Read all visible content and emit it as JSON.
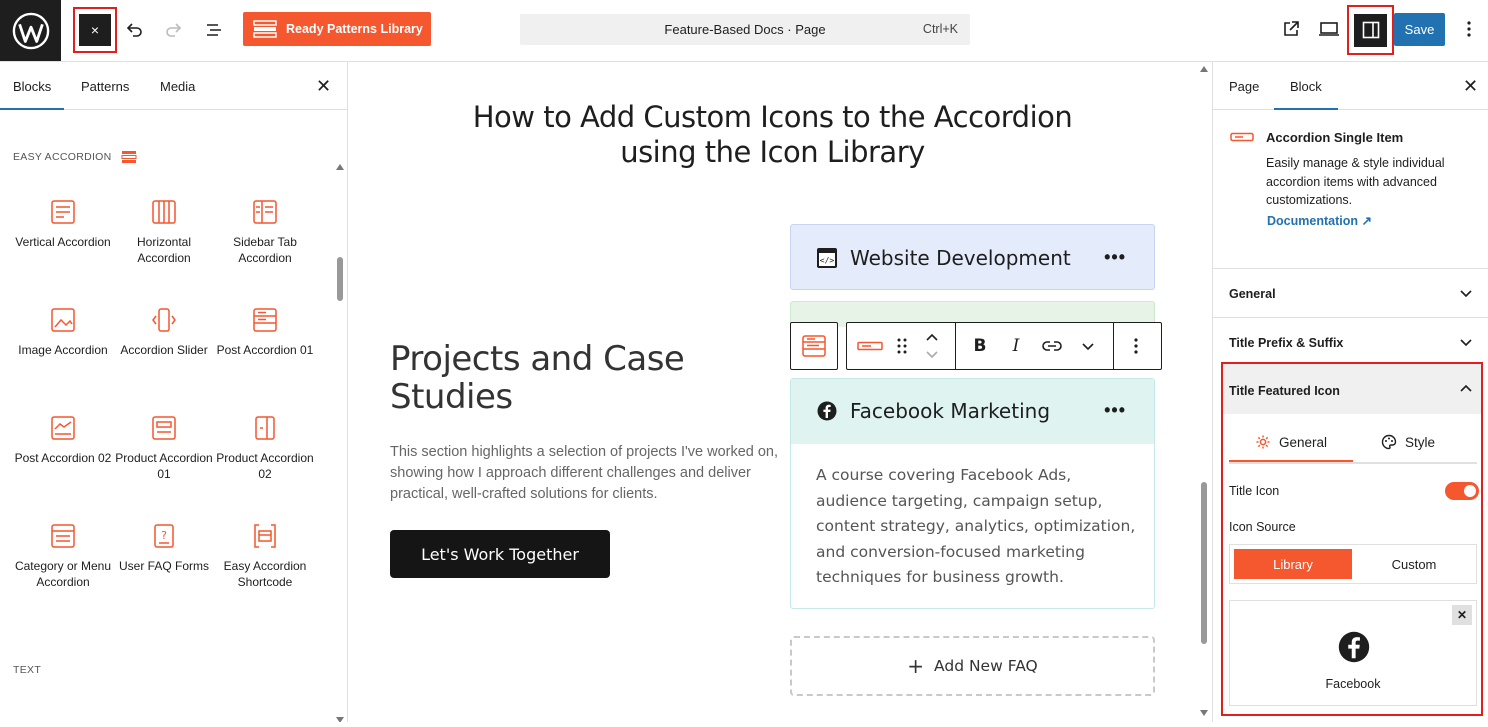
{
  "topbar": {
    "close_label": "×",
    "ready_patterns_label": "Ready Patterns Library",
    "command_title": "Feature-Based Docs · Page",
    "command_shortcut": "Ctrl+K",
    "save_label": "Save",
    "accent": "#f5572e",
    "save_color": "#2271b1"
  },
  "inserter": {
    "tabs": [
      "Blocks",
      "Patterns",
      "Media"
    ],
    "category_easy": "EASY ACCORDION",
    "category_text": "TEXT",
    "blocks": [
      {
        "label": "Vertical Accordion",
        "icon": "vertical-accordion-icon"
      },
      {
        "label": "Horizontal Accordion",
        "icon": "horizontal-accordion-icon"
      },
      {
        "label": "Sidebar Tab Accordion",
        "icon": "sidebar-tab-accordion-icon"
      },
      {
        "label": "Image Accordion",
        "icon": "image-accordion-icon"
      },
      {
        "label": "Accordion Slider",
        "icon": "accordion-slider-icon"
      },
      {
        "label": "Post Accordion 01",
        "icon": "post-accordion-icon"
      },
      {
        "label": "Post Accordion 02",
        "icon": "post-accordion-2-icon"
      },
      {
        "label": "Product Accordion 01",
        "icon": "product-accordion-icon"
      },
      {
        "label": "Product Accordion 02",
        "icon": "product-accordion-2-icon"
      },
      {
        "label": "Category or Menu Accordion",
        "icon": "category-accordion-icon"
      },
      {
        "label": "User FAQ Forms",
        "icon": "faq-form-icon"
      },
      {
        "label": "Easy Accordion Shortcode",
        "icon": "shortcode-icon"
      }
    ]
  },
  "canvas": {
    "heading": "How to Add Custom Icons to the Accordion using the Icon Library",
    "section_title": "Projects and Case Studies",
    "section_text": "This section highlights a selection of projects I've worked on, showing how I approach different challenges and deliver practical, well-crafted solutions for clients.",
    "cta_label": "Let's Work Together",
    "accordion_items": [
      {
        "title": "Website Development",
        "icon": "code-window-icon"
      },
      {
        "title": "Facebook Marketing",
        "icon": "facebook-icon",
        "body": "A course covering Facebook Ads, audience targeting, campaign setup, content strategy, analytics, optimization, and conversion-focused marketing techniques for business growth."
      }
    ],
    "toolbar": {
      "bold": "B",
      "italic": "I"
    },
    "add_faq_label": "Add New FAQ"
  },
  "settings": {
    "tabs": [
      "Page",
      "Block"
    ],
    "block_title": "Accordion Single Item",
    "block_desc": "Easily manage & style individual accordion items with advanced customizations.",
    "doc_link": "Documentation ↗",
    "sections": [
      "General",
      "Title Prefix & Suffix",
      "Title Featured Icon"
    ],
    "subtabs": [
      "General",
      "Style"
    ],
    "title_icon_label": "Title Icon",
    "title_icon_enabled": true,
    "icon_source_label": "Icon Source",
    "icon_source_options": [
      "Library",
      "Custom"
    ],
    "selected_icon_name": "Facebook",
    "remove_icon": "✕"
  }
}
